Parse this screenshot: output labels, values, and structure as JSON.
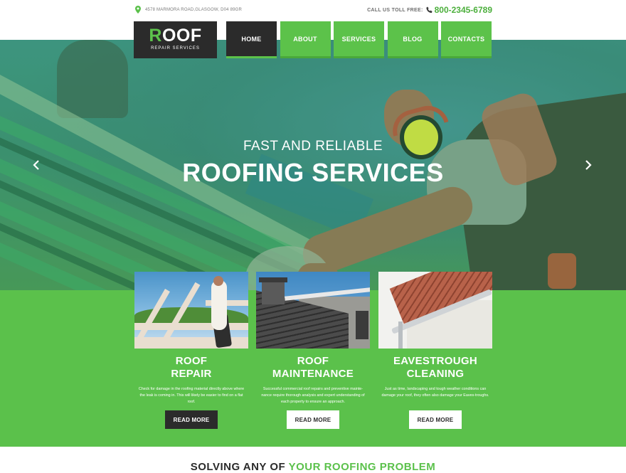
{
  "topbar": {
    "address": "4578 MARMORA ROAD,GLASGOW, D04 89GR",
    "toll_free_label": "CALL US TOLL FREE:",
    "phone": "800-2345-6789"
  },
  "logo": {
    "main_first": "R",
    "main_rest": "OOF",
    "sub": "REPAIR SERVICES"
  },
  "nav": {
    "items": [
      {
        "label": "HOME",
        "active": true
      },
      {
        "label": "ABOUT"
      },
      {
        "label": "SERVICES"
      },
      {
        "label": "BLOG"
      },
      {
        "label": "CONTACTS"
      }
    ]
  },
  "hero": {
    "subtitle": "FAST AND RELIABLE",
    "title": "ROOFING SERVICES"
  },
  "services": [
    {
      "title_line1": "ROOF",
      "title_line2": "REPAIR",
      "text": "Check for damage in the roofing material directly above where the leak is coming in. This will likely be easier to find on a flat roof.",
      "button": "READ MORE",
      "button_style": "dark"
    },
    {
      "title_line1": "ROOF",
      "title_line2": "MAINTENANCE",
      "text": "Successful commercial roof repairs and preventive mainte-nance require thorough analysis and expert understanding of each property to ensure an approach.",
      "button": "READ MORE",
      "button_style": "light"
    },
    {
      "title_line1": "EAVESTROUGH",
      "title_line2": "CLEANING",
      "text": "Just as time, landscaping and tough weather conditions can damage your roof, they often also damage your Eaves-troughs.",
      "button": "READ MORE",
      "button_style": "light"
    }
  ],
  "bottom": {
    "heading_part1": "SOLVING ANY OF",
    "heading_part2": "YOUR ROOFING PROBLEM"
  },
  "colors": {
    "accent": "#5bc14b",
    "dark": "#2b2b2b"
  },
  "icons": [
    "map-pin-icon",
    "phone-icon",
    "chevron-left-icon",
    "chevron-right-icon"
  ]
}
